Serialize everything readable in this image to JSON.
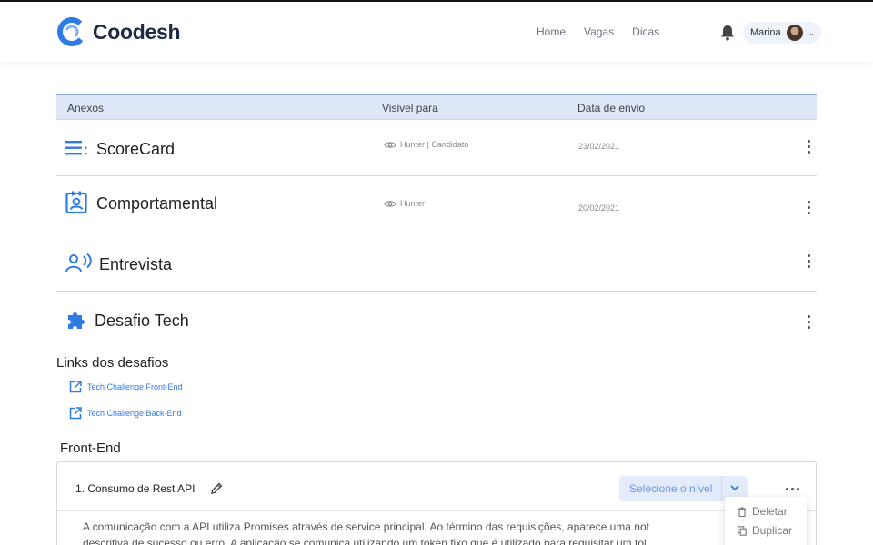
{
  "brand": {
    "name": "Coodesh"
  },
  "nav": {
    "home": "Home",
    "vagas": "Vagas",
    "dicas": "Dicas"
  },
  "user": {
    "name": "Marina"
  },
  "table": {
    "headers": {
      "anexos": "Anexos",
      "visivel": "Visivel para",
      "data": "Data de envio"
    },
    "rows": [
      {
        "title": "ScoreCard",
        "visible_to": "Hunter | Candidato",
        "date": "23/02/2021",
        "icon": "list-icon"
      },
      {
        "title": "Comportamental",
        "visible_to": "Hunter",
        "date": "20/02/2021",
        "icon": "badge-icon"
      },
      {
        "title": "Entrevista",
        "visible_to": "",
        "date": "",
        "icon": "voice-icon"
      },
      {
        "title": "Desafio Tech",
        "visible_to": "",
        "date": "",
        "icon": "puzzle-icon"
      }
    ]
  },
  "links_section": {
    "title": "Links dos desafios",
    "links": [
      "Tech Challenge Front-End",
      "Tech Challenge Back-End"
    ]
  },
  "frontend": {
    "title": "Front-End",
    "card": {
      "title": "1. Consumo de Rest API",
      "level_placeholder": "Selecione o nível",
      "body_line1": "A comunicação com a API utiliza Promises através de service principal. Ao término das requisições, aparece uma not",
      "body_line2": "descritiva de sucesso ou erro. A aplicação se comunica utilizando um token fixo que é utilizado para requisitar um tol"
    }
  },
  "context_menu": {
    "delete": "Deletar",
    "duplicate": "Duplicar"
  },
  "colors": {
    "accent": "#2f7be5",
    "header_bg": "#dde7f8",
    "select_bg": "#e4ecfb"
  }
}
